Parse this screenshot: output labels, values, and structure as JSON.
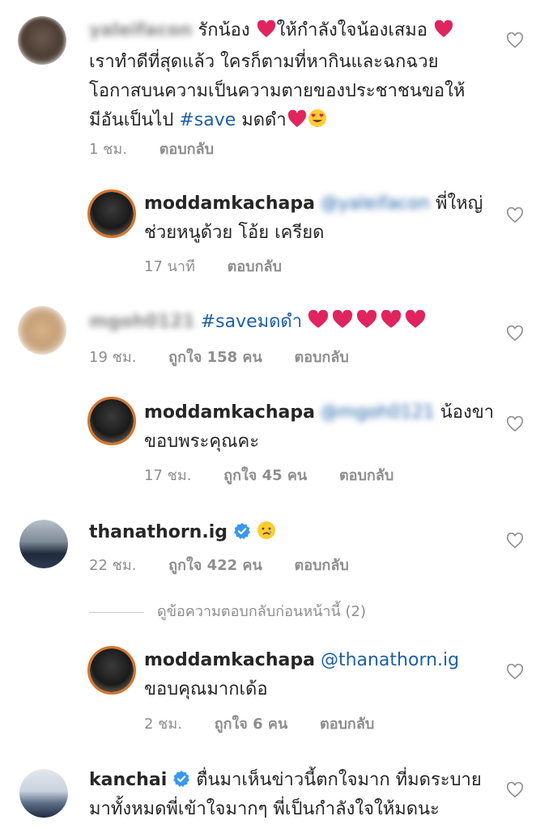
{
  "comments": [
    {
      "username": "yaleifacon",
      "text_line1": "รักน้อง",
      "text_line1b": "ให้กำลังใจน้องเสมอ",
      "text_line2": "เราทำดีที่สุดแล้ว ใครก็ตามที่หากินและฉกฉวย",
      "text_line3": "โอกาสบนความเป็นความตายของประชาชนขอให้",
      "text_line4a": "มีอันเป็นไป",
      "hashtag": "#save",
      "text_line4b": "มดดำ",
      "time": "1 ชม.",
      "reply_label": "ตอบกลับ"
    },
    {
      "username": "moddamkachapa",
      "mention": "@yaleifacon",
      "text_a": "พี่ใหญ่",
      "text_b": "ช่วยหนูด้วย โอ้ย เครียด",
      "time": "17 นาที",
      "reply_label": "ตอบกลับ"
    },
    {
      "username": "mgoh0121",
      "hashtag": "#saveมดดำ",
      "time": "19 ชม.",
      "likes": "ถูกใจ 158 คน",
      "reply_label": "ตอบกลับ"
    },
    {
      "username": "moddamkachapa",
      "mention": "@mgoh0121",
      "text_a": "น้องขา",
      "text_b": "ขอบพระคุณคะ",
      "time": "17 ชม.",
      "likes": "ถูกใจ 45 คน",
      "reply_label": "ตอบกลับ"
    },
    {
      "username": "thanathorn.ig",
      "time": "22 ชม.",
      "likes": "ถูกใจ 422 คน",
      "reply_label": "ตอบกลับ"
    },
    {
      "username": "moddamkachapa",
      "mention": "@thanathorn.ig",
      "text_b": "ขอบคุณมากเด้อ",
      "time": "2 ชม.",
      "likes": "ถูกใจ 6 คน",
      "reply_label": "ตอบกลับ"
    },
    {
      "username": "kanchai",
      "text_line1": "ตื่นมาเห็นข่าวนี้ตกใจมาก ที่มดระบาย",
      "text_line2": "มาทั้งหมดพี่เข้าใจมากๆ พี่เป็นกำลังใจให้มดนะ"
    }
  ],
  "view_previous_replies": "ดูข้อความตอบกลับก่อนหน้านี้ (2)",
  "colors": {
    "ring": "#d8742a",
    "verified": "#3897f0",
    "heart": "#e0245e",
    "link": "#1d5fa8"
  }
}
